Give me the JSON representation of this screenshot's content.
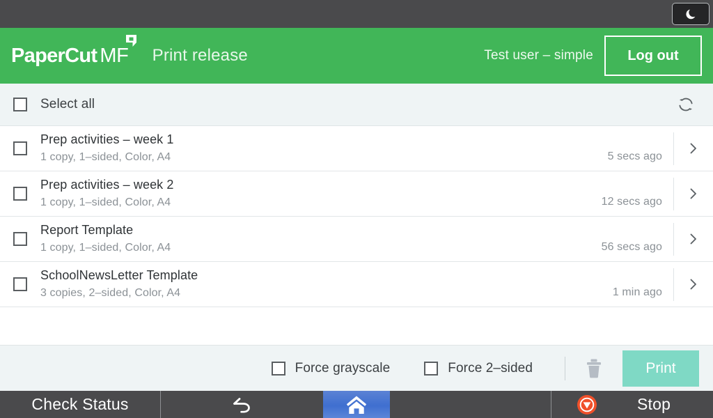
{
  "device_bar": {
    "sleep_button": {
      "icon": "moon-icon",
      "label": ""
    }
  },
  "header": {
    "logo_primary": "PaperCut",
    "logo_secondary": "MF",
    "title": "Print release",
    "user": "Test user – simple",
    "logout_label": "Log out",
    "background_color": "#41b658"
  },
  "toolbar": {
    "select_all_label": "Select all",
    "refresh_icon": "refresh-icon"
  },
  "jobs": [
    {
      "title": "Prep activities – week 1",
      "details": "1 copy, 1–sided, Color, A4",
      "time": "5 secs ago",
      "selected": false
    },
    {
      "title": "Prep activities – week 2",
      "details": "1 copy, 1–sided, Color, A4",
      "time": "12 secs ago",
      "selected": false
    },
    {
      "title": "Report Template",
      "details": "1 copy, 1–sided, Color, A4",
      "time": "56 secs ago",
      "selected": false
    },
    {
      "title": "SchoolNewsLetter Template",
      "details": "3 copies, 2–sided, Color, A4",
      "time": "1 min ago",
      "selected": false
    }
  ],
  "action_bar": {
    "force_grayscale_label": "Force grayscale",
    "force_grayscale_checked": false,
    "force_duplex_label": "Force 2–sided",
    "force_duplex_checked": false,
    "delete_icon": "trash-icon",
    "print_label": "Print",
    "print_enabled": false,
    "print_color": "#7fd9c5"
  },
  "nav_bar": {
    "check_status_label": "Check Status",
    "back_icon": "back-arrow-icon",
    "home_icon": "home-icon",
    "home_color": "#3f6fd0",
    "stop_label": "Stop",
    "stop_icon": "stop-icon",
    "stop_color": "#f0502a"
  }
}
